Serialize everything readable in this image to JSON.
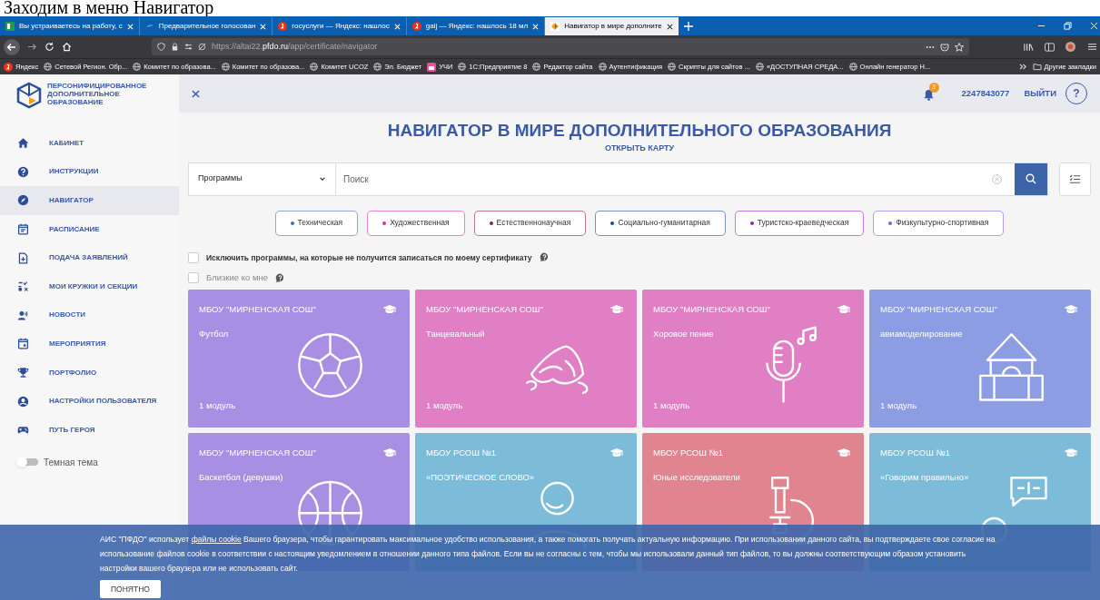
{
  "caption": "Заходим в меню Навигатор",
  "browser": {
    "tabs": [
      {
        "title": "Вы устраиваетесь на работу, с",
        "kind": "sheet",
        "selected": false
      },
      {
        "title": "Предварительное голосован",
        "kind": "wave",
        "selected": false
      },
      {
        "title": "госуслуги — Яндекс: нашлос",
        "kind": "yandex",
        "selected": false
      },
      {
        "title": "galj — Яндекс: нашлось 18 мл",
        "kind": "yandex",
        "selected": false
      },
      {
        "title": "Навигатор в мире дополните",
        "kind": "site",
        "selected": true
      }
    ],
    "url_host_prefix": "https://altai22.",
    "url_host": "pfdo.ru",
    "url_path": "/app/certificate/navigator",
    "bookmarks": [
      {
        "label": "Яндекс",
        "kind": "yandex"
      },
      {
        "label": "Сетевой Регион. Обр...",
        "kind": "globe"
      },
      {
        "label": "Комитет по образова...",
        "kind": "globe"
      },
      {
        "label": "Комитет по образова...",
        "kind": "globe"
      },
      {
        "label": "Комитет UCOZ",
        "kind": "globe"
      },
      {
        "label": "Эл. Бюджет",
        "kind": "globe"
      },
      {
        "label": "УЧИ",
        "kind": "uchi"
      },
      {
        "label": "1С:Предприятие 8",
        "kind": "globe"
      },
      {
        "label": "Редактор сайта",
        "kind": "globe"
      },
      {
        "label": "Аутентификация",
        "kind": "globe"
      },
      {
        "label": "Скрипты для сайтов ...",
        "kind": "globe"
      },
      {
        "label": "«ДОСТУПНАЯ СРЕДА...",
        "kind": "globe"
      },
      {
        "label": "Онлайн генератор Н...",
        "kind": "globe"
      }
    ],
    "other_bookmarks": "Другие закладки"
  },
  "logo_lines": [
    "ПЕРСОНИФИЦИРОВАННОЕ",
    "ДОПОЛНИТЕЛЬНОЕ",
    "ОБРАЗОВАНИЕ"
  ],
  "sidebar": {
    "items": [
      {
        "label": "КАБИНЕТ",
        "kind": "home",
        "selected": false
      },
      {
        "label": "ИНСТРУКЦИИ",
        "kind": "help",
        "selected": false
      },
      {
        "label": "НАВИГАТОР",
        "kind": "compass",
        "selected": true
      },
      {
        "label": "РАСПИСАНИЕ",
        "kind": "schedule",
        "selected": false
      },
      {
        "label": "ПОДАЧА ЗАЯВЛЕНИЙ",
        "kind": "file",
        "selected": false
      },
      {
        "label": "МОИ КРУЖКИ И СЕКЦИИ",
        "kind": "sports",
        "selected": false
      },
      {
        "label": "НОВОСТИ",
        "kind": "speaker",
        "selected": false
      },
      {
        "label": "МЕРОПРИЯТИЯ",
        "kind": "event",
        "selected": false
      },
      {
        "label": "ПОРТФОЛИО",
        "kind": "trophy",
        "selected": false
      },
      {
        "label": "НАСТРОЙКИ ПОЛЬЗОВАТЕЛЯ",
        "kind": "user",
        "selected": false
      },
      {
        "label": "ПУТЬ ГЕРОЯ",
        "kind": "gamepad",
        "selected": false
      }
    ],
    "theme_toggle": {
      "label": "Темная тема",
      "on": false
    }
  },
  "header": {
    "notifications": "3",
    "user_id": "2247843077",
    "logout": "ВЫЙТИ",
    "help": "?"
  },
  "title": "НАВИГАТОР В МИРЕ ДОПОЛНИТЕЛЬНОГО ОБРАЗОВАНИЯ",
  "map_link": "ОТКРЫТЬ КАРТУ",
  "search": {
    "category": "Программы",
    "placeholder": "Поиск"
  },
  "directions": [
    {
      "label": "Техническая",
      "color": "#3f6fb5"
    },
    {
      "label": "Художественная",
      "color": "#d62fa0"
    },
    {
      "label": "Естественнонаучная",
      "color": "#8b1a50"
    },
    {
      "label": "Социально-гуманитарная",
      "color": "#1e4d8c"
    },
    {
      "label": "Туристско-краеведческая",
      "color": "#a020c0"
    },
    {
      "label": "Физкультурно-спортивная",
      "color": "#8a5ae0"
    }
  ],
  "filters": [
    {
      "label": "Исключить программы, на которые не получится записаться по моему сертификату",
      "checked": false,
      "kind": "main"
    },
    {
      "label": "Близкие ко мне",
      "checked": false,
      "kind": "near"
    }
  ],
  "cards": [
    {
      "org": "МБОУ \"МИРНЕНСКАЯ СОШ\"",
      "name": "Футбол",
      "modules": "1 модуль",
      "color": "#a98fe4",
      "kind": "ball"
    },
    {
      "org": "МБОУ \"МИРНЕНСКАЯ СОШ\"",
      "name": "Танцевальный",
      "modules": "1 модуль",
      "color": "#e07fc4",
      "kind": "shoes"
    },
    {
      "org": "МБОУ \"МИРНЕНСКАЯ СОШ\"",
      "name": "Хоровое пение",
      "modules": "1 модуль",
      "color": "#e07fc4",
      "kind": "mic"
    },
    {
      "org": "МБОУ \"МИРНЕНСКАЯ СОШ\"",
      "name": "авиамоделирование",
      "modules": "1 модуль",
      "color": "#8d9de4",
      "kind": "blocks"
    },
    {
      "org": "МБОУ \"МИРНЕНСКАЯ СОШ\"",
      "name": "Баскетбол (девушки)",
      "color": "#a98fe4",
      "kind": "basketball"
    },
    {
      "org": "МБОУ РСОШ №1",
      "name": "«ПОЭТИЧЕСКОЕ СЛОВО»",
      "color": "#7dbcd8",
      "kind": "person"
    },
    {
      "org": "МБОУ РСОШ №1",
      "name": "Юные исследователи",
      "color": "#e0848f",
      "kind": "microscope"
    },
    {
      "org": "МБОУ РСОШ №1",
      "name": "«Говорим правильно»",
      "color": "#7dbcd8",
      "kind": "speech"
    }
  ],
  "cookie": {
    "before": "АИС \"ПФДО\" использует ",
    "link": "файлы cookie",
    "after": " Вашего браузера, чтобы гарантировать максимальное удобство использования, а также помогать получать актуальную информацию. При использовании данного сайта, вы подтверждаете свое согласие на использование файлов cookie в соответствии с настоящим уведомлением в отношении данного типа файлов. Если вы не согласны с тем, чтобы мы использовали данный тип файлов, то вы должны соответствующим образом установить настройки вашего браузера или не использовать сайт.",
    "button": "ПОНЯТНО"
  }
}
